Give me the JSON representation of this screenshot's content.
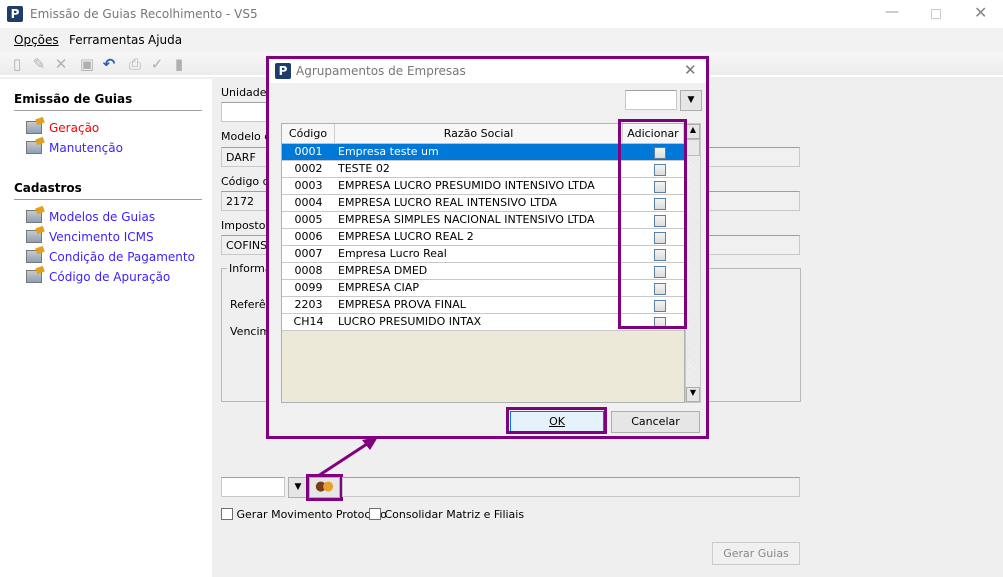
{
  "window": {
    "title": "Emissão de Guias Recolhimento - VS5",
    "logo": "P"
  },
  "menu": [
    "Opções",
    "Ferramentas",
    "Ajuda"
  ],
  "sidebar": {
    "section1": "Emissão de Guias",
    "items1": [
      "Geração",
      "Manutenção"
    ],
    "section2": "Cadastros",
    "items2": [
      "Modelos de Guias",
      "Vencimento ICMS",
      "Condição de Pagamento",
      "Código de Apuração"
    ]
  },
  "form": {
    "unidade_label": "Unidade d",
    "modelo_label": "Modelo da",
    "modelo_value": "DARF",
    "codigo_label": "Código de",
    "codigo_value": "2172",
    "imposto_label": "Imposto",
    "imposto_value": "COFINS",
    "info_group": "Informaç",
    "referencia_label": "Referên",
    "vencimento_label": "Vencime",
    "gerar_mov": "Gerar Movimento Protocolo",
    "consolidar": "Consolidar Matriz e Filiais",
    "gerar_guias": "Gerar Guias"
  },
  "dialog": {
    "title": "Agrupamentos de Empresas",
    "columns": [
      "Código",
      "Razão Social",
      "Adicionar"
    ],
    "rows": [
      {
        "code": "0001",
        "name": "Empresa teste um"
      },
      {
        "code": "0002",
        "name": "TESTE 02"
      },
      {
        "code": "0003",
        "name": "EMPRESA LUCRO PRESUMIDO INTENSIVO LTDA"
      },
      {
        "code": "0004",
        "name": "EMPRESA LUCRO REAL INTENSIVO LTDA"
      },
      {
        "code": "0005",
        "name": "EMPRESA SIMPLES NACIONAL INTENSIVO LTDA"
      },
      {
        "code": "0006",
        "name": "EMPRESA LUCRO REAL 2"
      },
      {
        "code": "0007",
        "name": "Empresa Lucro Real"
      },
      {
        "code": "0008",
        "name": "EMPRESA DMED"
      },
      {
        "code": "0099",
        "name": "EMPRESA CIAP"
      },
      {
        "code": "2203",
        "name": "EMPRESA PROVA FINAL"
      },
      {
        "code": "CH14",
        "name": "LUCRO PRESUMIDO INTAX"
      }
    ],
    "ok": "OK",
    "cancel": "Cancelar"
  },
  "colors": {
    "highlight": "#800080",
    "selection": "#0078d7",
    "link": "#3a1fff",
    "active": "#ff0000"
  }
}
